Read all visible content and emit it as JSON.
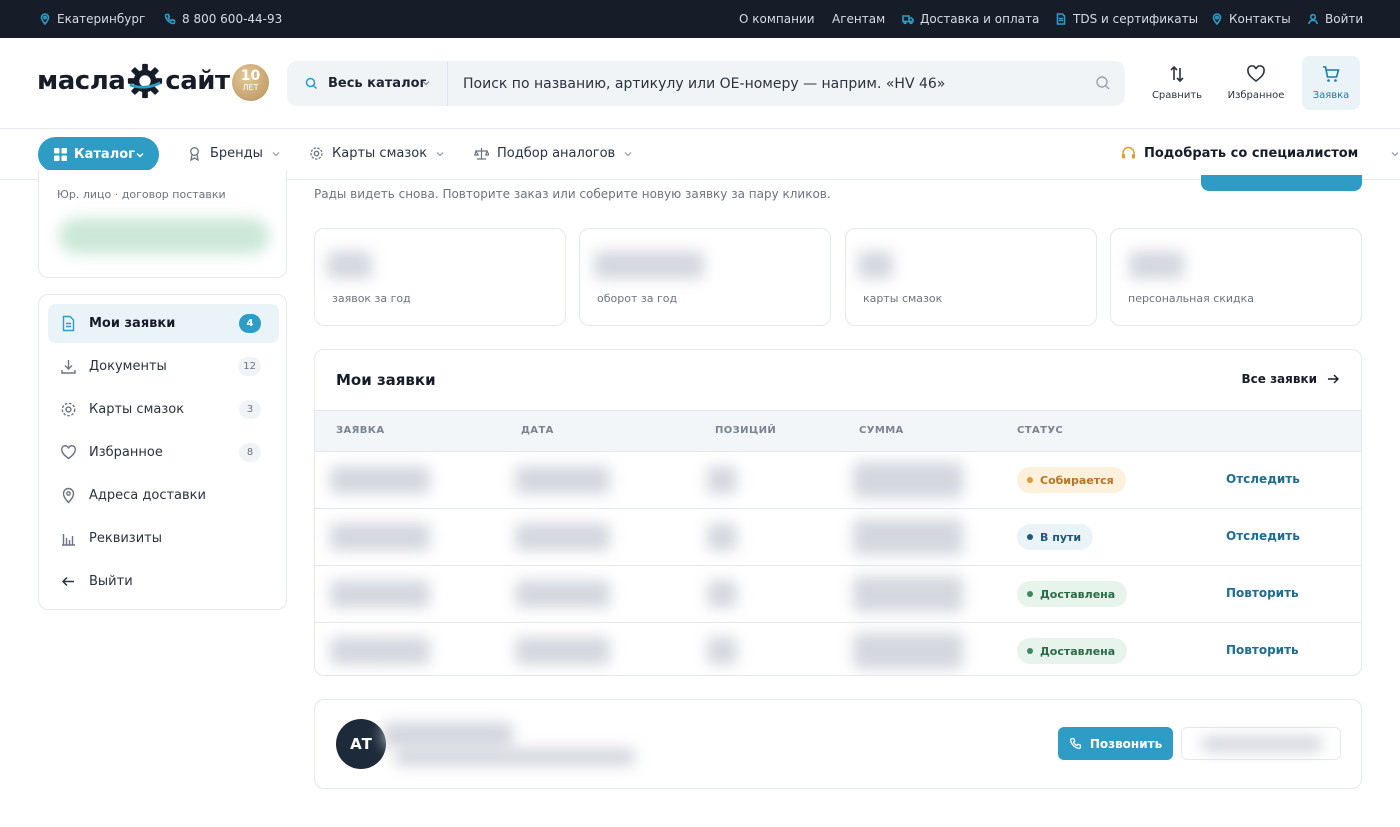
{
  "topbar": {
    "city": "Екатеринбург",
    "phone": "8 800 600-44-93",
    "links": [
      "О компании",
      "Агентам",
      "Доставка и оплата",
      "TDS и сертификаты",
      "Контакты",
      "Войти"
    ]
  },
  "logo": {
    "left": "масла",
    "right": "сайт",
    "badge_num": "10",
    "badge_unit": "ЛЕТ"
  },
  "search": {
    "scope": "Весь каталог",
    "placeholder": "Поиск по названию, артикулу или OE-номеру — наприм. «HV 46»"
  },
  "header_actions": {
    "compare": "Сравнить",
    "favorites": "Избранное",
    "request": "Заявка"
  },
  "nav": {
    "catalog": "Каталог",
    "brands": "Бренды",
    "cards": "Карты смазок",
    "analogs": "Подбор аналогов",
    "specialist": "Подобрать со специалистом"
  },
  "account": {
    "type": "Юр. лицо · договор поставки"
  },
  "sidebar": {
    "items": [
      {
        "label": "Мои заявки",
        "count": "4"
      },
      {
        "label": "Документы",
        "count": "12"
      },
      {
        "label": "Карты смазок",
        "count": "3"
      },
      {
        "label": "Избранное",
        "count": "8"
      },
      {
        "label": "Адреса доставки"
      },
      {
        "label": "Реквизиты"
      },
      {
        "label": "Выйти"
      }
    ]
  },
  "main": {
    "welcome": "Рады видеть снова. Повторите заказ или соберите новую заявку за пару кликов.",
    "stats": [
      {
        "label": "заявок за год"
      },
      {
        "label": "оборот за год"
      },
      {
        "label": "карты смазок"
      },
      {
        "label": "персональная скидка"
      }
    ]
  },
  "orders": {
    "title": "Мои заявки",
    "all_link": "Все заявки",
    "columns": [
      "ЗАЯВКА",
      "ДАТА",
      "ПОЗИЦИЙ",
      "СУММА",
      "СТАТУС"
    ],
    "rows": [
      {
        "status": "Собирается",
        "action": "Отследить"
      },
      {
        "status": "В пути",
        "action": "Отследить"
      },
      {
        "status": "Доставлена",
        "action": "Повторить"
      },
      {
        "status": "Доставлена",
        "action": "Повторить"
      }
    ]
  },
  "manager": {
    "initials": "АТ",
    "call": "Позвонить"
  },
  "colors": {
    "accent": "#2e9cc4",
    "dark": "#161d29",
    "status_collect": "#e49a2e",
    "status_road": "#1e5a73",
    "status_done": "#3a8a5c"
  }
}
